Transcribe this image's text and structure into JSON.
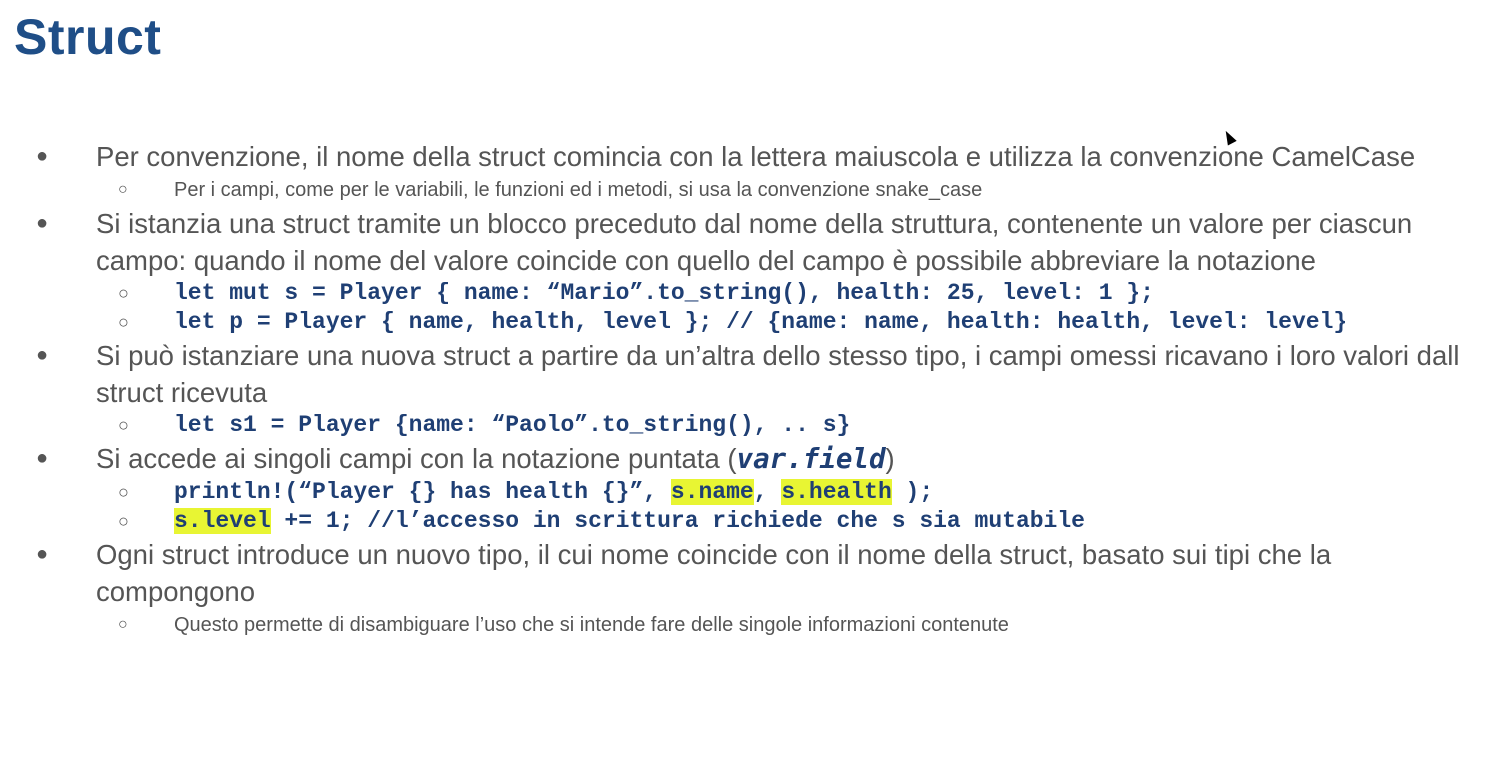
{
  "title": "Struct",
  "bullets": {
    "b1": {
      "text": "Per convenzione, il nome della struct comincia con la lettera maiuscola e utilizza la convenzione CamelCase",
      "sub1": "Per i campi, come per le variabili, le funzioni ed i metodi, si usa la convenzione snake_case"
    },
    "b2": {
      "text": "Si istanzia una struct tramite un blocco preceduto dal nome della struttura, contenente un valore per ciascun campo: quando il nome del valore coincide con quello del campo è possibile abbreviare la notazione",
      "code1": "let mut s = Player { name: “Mario”.to_string(), health: 25, level: 1 };",
      "code2": "let p = Player { name, health, level }; // {name: name, health: health, level: level}"
    },
    "b3": {
      "text": "Si può istanziare una nuova struct a partire da un’altra dello stesso tipo, i campi omessi ricavano i loro valori dall struct ricevuta",
      "code1": "let s1 = Player {name: “Paolo”.to_string(), .. s}"
    },
    "b4": {
      "text_before": "Si accede ai singoli campi con la notazione puntata (",
      "inline_code": "var.field",
      "text_after": ")",
      "code1_prefix": "println!(“Player {} has health {}”, ",
      "code1_hl1": "s.name",
      "code1_sep": ", ",
      "code1_hl2": "s.health",
      "code1_suffix": " );",
      "code2_hl": "s.level",
      "code2_rest": " += 1; //l’accesso in scrittura richiede che s sia mutabile"
    },
    "b5": {
      "text": "Ogni struct introduce un nuovo tipo, il cui nome coincide con il nome della struct, basato sui tipi che la compongono",
      "sub1": "Questo permette di disambiguare l’uso che si intende fare delle singole informazioni contenute"
    }
  },
  "colors": {
    "title": "#1f4e87",
    "body_text": "#555555",
    "code": "#1f3f74",
    "highlight": "#e8f533"
  }
}
